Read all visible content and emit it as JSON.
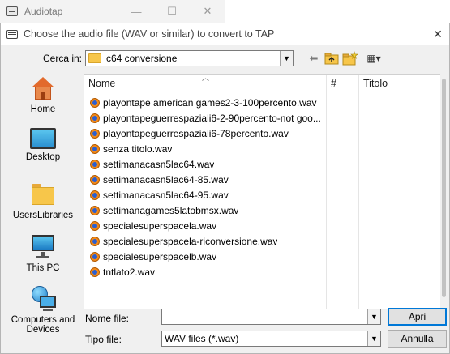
{
  "background_window": {
    "title": "Audiotap",
    "minimize_glyph": "—",
    "maximize_glyph": "☐",
    "close_glyph": "✕"
  },
  "dialog": {
    "title": "Choose the audio file (WAV or similar) to convert to TAP",
    "close_glyph": "✕"
  },
  "toolbar": {
    "look_in_label": "Cerca in:",
    "look_in_value": "c64 conversione",
    "back_glyph": "⬅",
    "view_glyph": "▦▾"
  },
  "places": [
    {
      "label": "Home",
      "icon": "home-icon"
    },
    {
      "label": "Desktop",
      "icon": "desktop-icon"
    },
    {
      "label": "UsersLibraries",
      "icon": "folder-icon"
    },
    {
      "label": "This PC",
      "icon": "computer-icon"
    },
    {
      "label": "Computers and Devices",
      "icon": "network-icon"
    }
  ],
  "file_list": {
    "columns": {
      "name": "Nome",
      "number": "#",
      "title": "Titolo"
    },
    "files": [
      "playontape american games2-3-100percento.wav",
      "playontapeguerrespaziali6-2-90percento-not goo...",
      "playontapeguerrespaziali6-78percento.wav",
      "senza titolo.wav",
      "settimanacasn5lac64.wav",
      "settimanacasn5lac64-85.wav",
      "settimanacasn5lac64-95.wav",
      "settimanagames5latobmsx.wav",
      "specialesuperspacela.wav",
      "specialesuperspacela-riconversione.wav",
      "specialesuperspacelb.wav",
      "tntlato2.wav"
    ]
  },
  "bottom": {
    "filename_label": "Nome file:",
    "filename_value": "",
    "filetype_label": "Tipo file:",
    "filetype_value": "WAV files (*.wav)",
    "open_button": "Apri",
    "cancel_button": "Annulla"
  }
}
